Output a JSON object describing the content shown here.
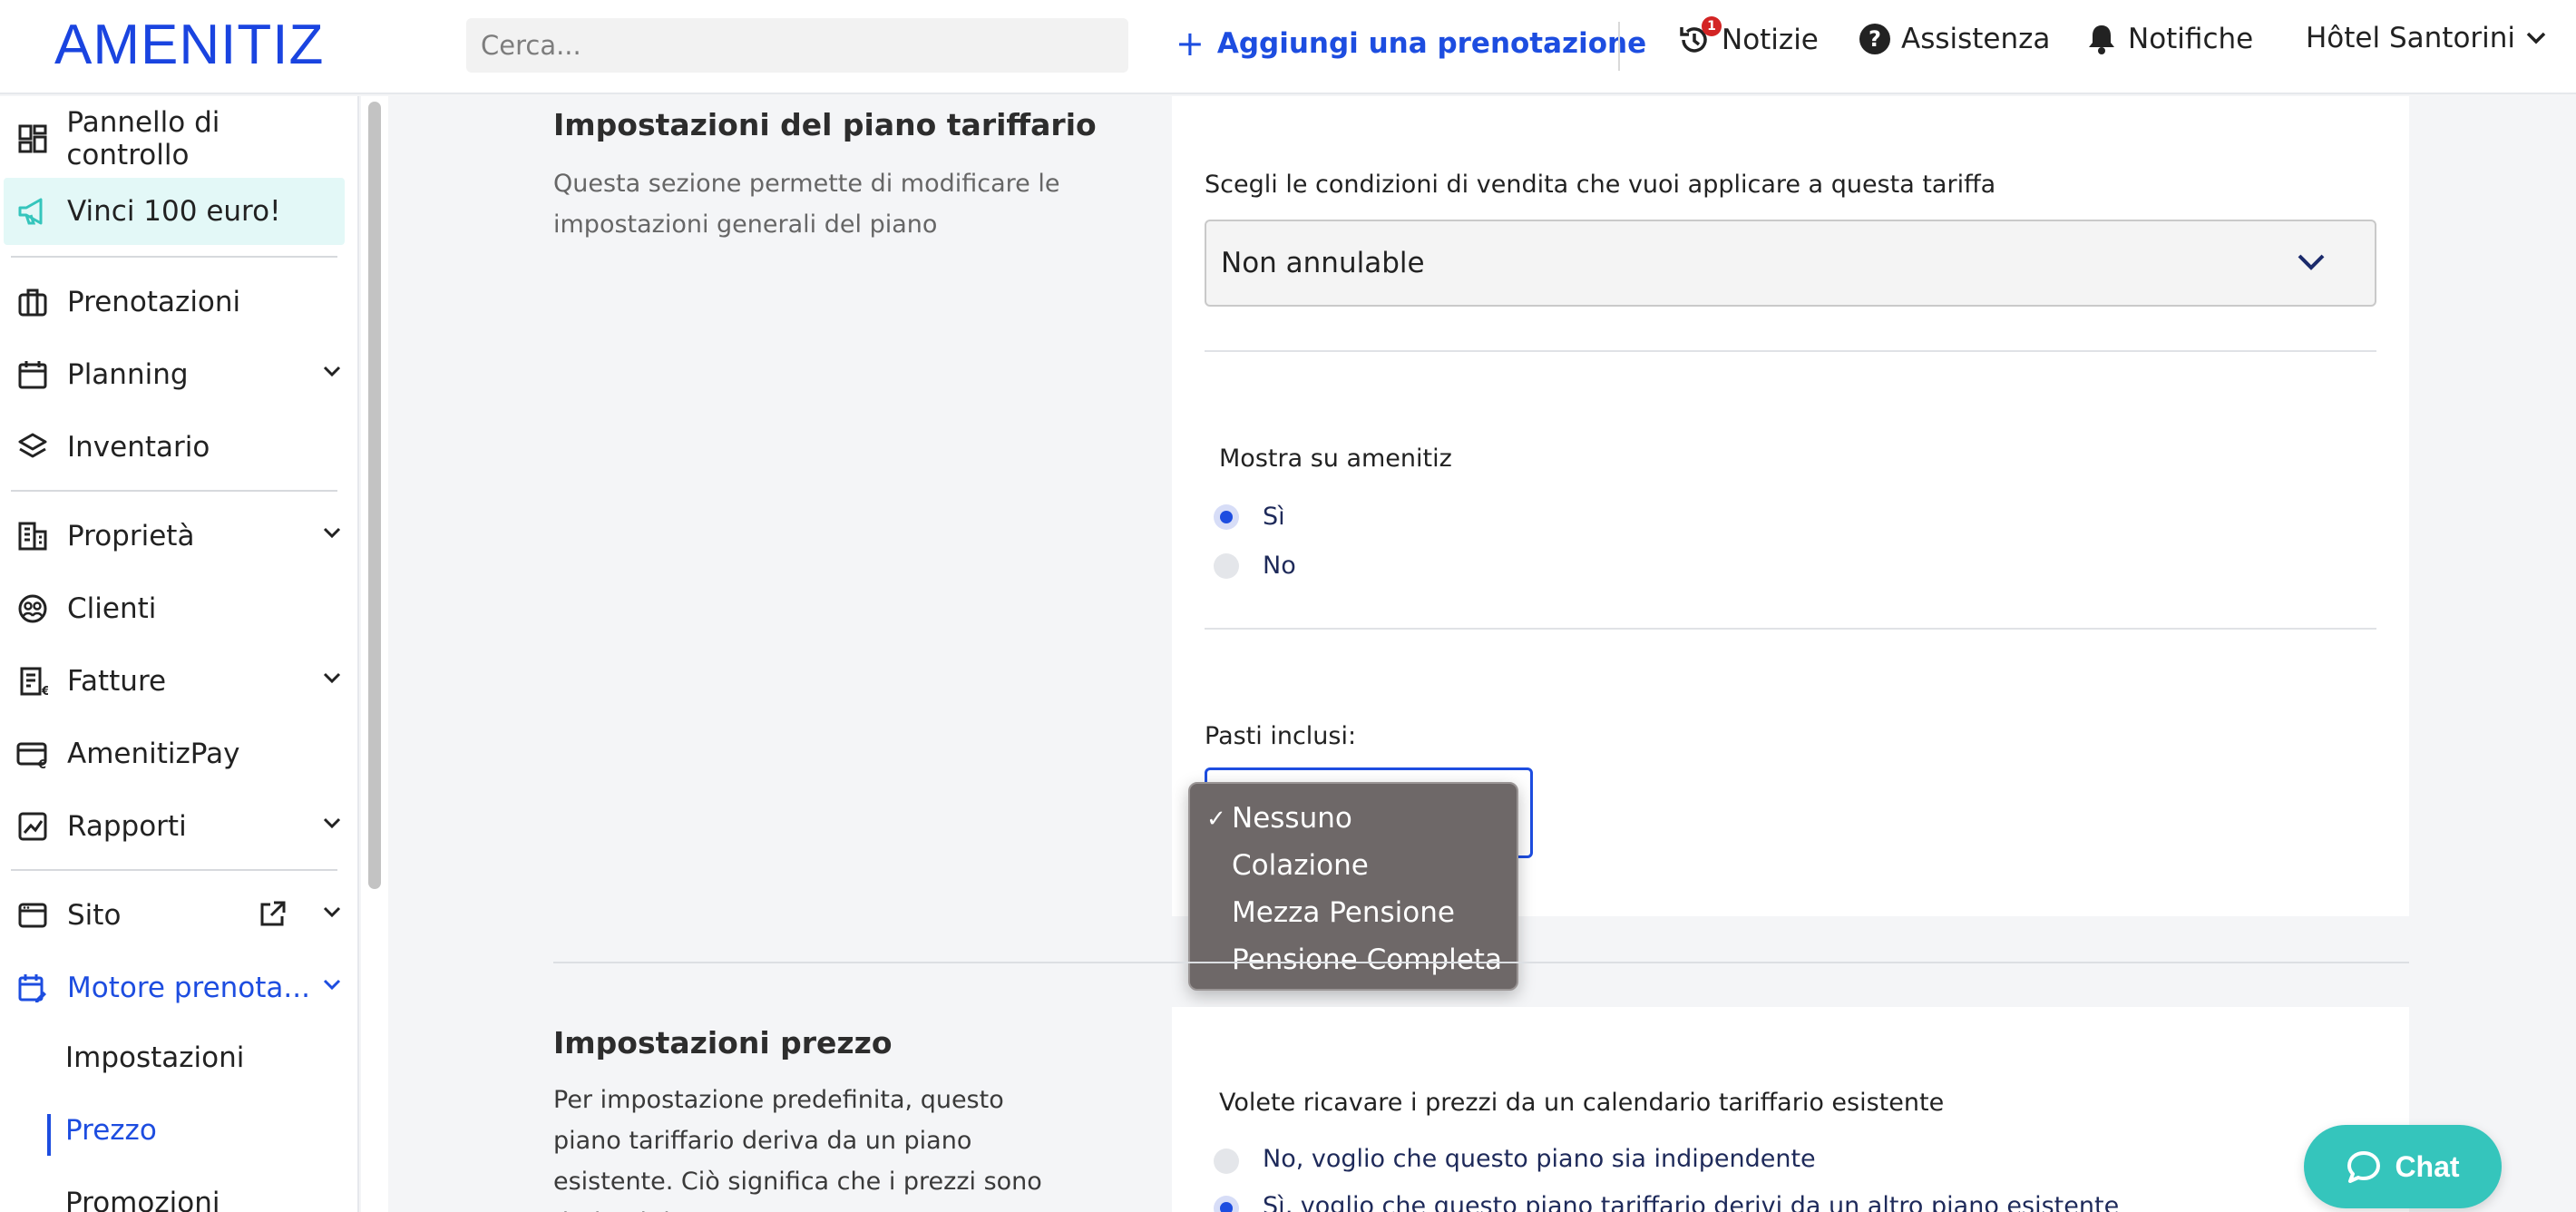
{
  "header": {
    "logo": "AMENITIZ",
    "search_placeholder": "Cerca...",
    "add_reservation": "Aggiungi una prenotazione",
    "news": "Notizie",
    "news_badge": "1",
    "help": "Assistenza",
    "notifications": "Notifiche",
    "property": "Hôtel Santorini"
  },
  "sidebar": {
    "dashboard": "Pannello di controllo",
    "promo": "Vinci 100 euro!",
    "reservations": "Prenotazioni",
    "planning": "Planning",
    "inventory": "Inventario",
    "property": "Proprietà",
    "clients": "Clienti",
    "invoices": "Fatture",
    "amenitizpay": "AmenitizPay",
    "reports": "Rapporti",
    "site": "Sito",
    "booking_engine": "Motore prenota...",
    "sub_settings": "Impostazioni",
    "sub_price": "Prezzo",
    "sub_promotions": "Promozioni"
  },
  "rate_plan": {
    "title": "Impostazioni del piano tariffario",
    "description": "Questa sezione permette di modificare le impostazioni generali del piano",
    "conditions_label": "Scegli le condizioni di vendita che vuoi applicare a questa tariffa",
    "conditions_value": "Non annulable",
    "show_label": "Mostra su amenitiz",
    "show_yes": "Sì",
    "show_no": "No",
    "meals_label": "Pasti inclusi:",
    "meal_options": [
      "Nessuno",
      "Colazione",
      "Mezza Pensione",
      "Pensione Completa"
    ],
    "meal_selected": "Nessuno"
  },
  "price": {
    "title": "Impostazioni prezzo",
    "description": "Per impostazione predefinita, questo piano tariffario deriva da un piano esistente. Ciò significa che i prezzi sono derivati da questo",
    "question": "Volete ricavare i prezzi da un calendario tariffario esistente",
    "option_independent": "No, voglio che questo piano sia indipendente",
    "option_derived": "Sì, voglio che questo piano tariffario derivi da un altro piano esistente"
  },
  "chat": {
    "label": "Chat"
  },
  "colors": {
    "accent": "#1d4de0",
    "chat": "#35c5bc",
    "promo_bg": "#e3f8f7"
  }
}
